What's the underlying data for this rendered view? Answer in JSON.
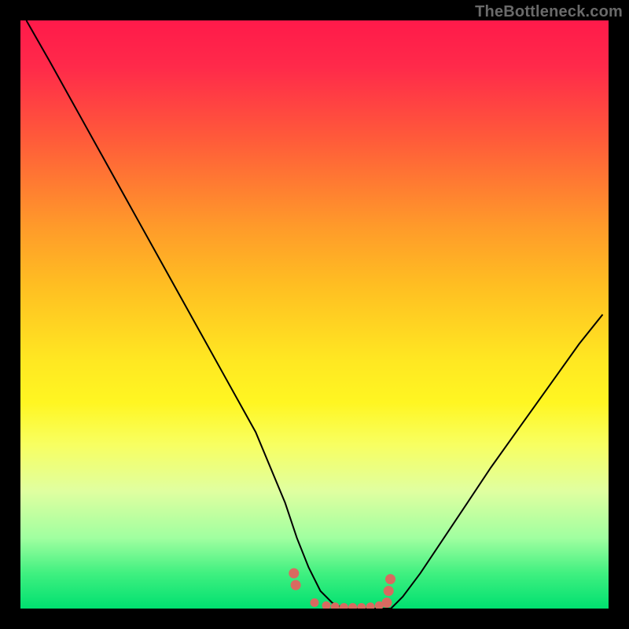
{
  "watermark": "TheBottleneck.com",
  "chart_data": {
    "type": "line",
    "title": "",
    "xlabel": "",
    "ylabel": "",
    "xlim": [
      0,
      100
    ],
    "ylim": [
      0,
      100
    ],
    "series": [
      {
        "name": "bottleneck-curve",
        "x": [
          1,
          5,
          10,
          15,
          20,
          25,
          30,
          35,
          40,
          45,
          47,
          49,
          51,
          53,
          55,
          57,
          59,
          61,
          63,
          65,
          68,
          72,
          76,
          80,
          85,
          90,
          95,
          99
        ],
        "y": [
          100,
          93,
          84,
          75,
          66,
          57,
          48,
          39,
          30,
          18,
          12,
          7,
          3,
          1,
          0,
          0,
          0,
          0,
          0,
          2,
          6,
          12,
          18,
          24,
          31,
          38,
          45,
          50
        ]
      }
    ],
    "markers": {
      "name": "sweet-spot-markers",
      "x": [
        46.5,
        46.8,
        50,
        52,
        53.5,
        55,
        56.5,
        58,
        59.5,
        61,
        62.3,
        62.6,
        62.9
      ],
      "y": [
        6,
        4,
        1,
        0.5,
        0.3,
        0.2,
        0.2,
        0.2,
        0.3,
        0.5,
        1,
        3,
        5
      ]
    },
    "gradient_stops": [
      {
        "pct": 0,
        "color": "#ff1a4a"
      },
      {
        "pct": 8,
        "color": "#ff2a4a"
      },
      {
        "pct": 20,
        "color": "#ff5a3a"
      },
      {
        "pct": 35,
        "color": "#ff9a2a"
      },
      {
        "pct": 45,
        "color": "#ffbe22"
      },
      {
        "pct": 58,
        "color": "#ffe822"
      },
      {
        "pct": 65,
        "color": "#fff622"
      },
      {
        "pct": 72,
        "color": "#f8ff60"
      },
      {
        "pct": 80,
        "color": "#e0ffa0"
      },
      {
        "pct": 88,
        "color": "#a0ffa0"
      },
      {
        "pct": 94,
        "color": "#40f080"
      },
      {
        "pct": 100,
        "color": "#00e070"
      }
    ]
  }
}
